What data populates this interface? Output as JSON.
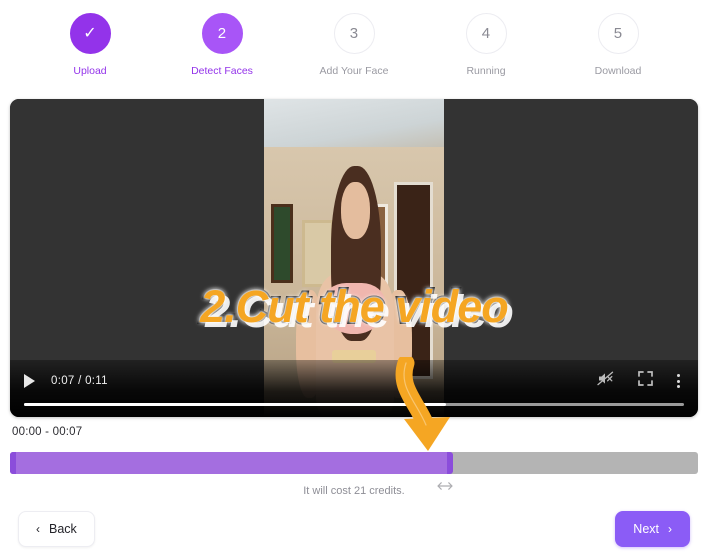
{
  "stepper": {
    "steps": [
      {
        "indicator": "✓",
        "label": "Upload",
        "state": "done"
      },
      {
        "indicator": "2",
        "label": "Detect Faces",
        "state": "active"
      },
      {
        "indicator": "3",
        "label": "Add Your Face",
        "state": "todo"
      },
      {
        "indicator": "4",
        "label": "Running",
        "state": "todo"
      },
      {
        "indicator": "5",
        "label": "Download",
        "state": "todo"
      }
    ]
  },
  "video": {
    "overlay_text": "2.Cut the video",
    "current_time": "0:07",
    "duration": "0:11",
    "time_display": "0:07 / 0:11",
    "progress_percent": 64,
    "muted": true,
    "icons": {
      "play": "play-icon",
      "mute": "muted-volume-icon",
      "fullscreen": "fullscreen-icon",
      "menu": "more-options-icon"
    }
  },
  "trim": {
    "range_label": "00:00 - 00:07",
    "start": "00:00",
    "end": "00:07",
    "selected_percent": 64,
    "credits_note": "It will cost 21 credits.",
    "credits_count": 21
  },
  "annotation": {
    "arrow": "curved-down-arrow",
    "arrow_color": "#F5A623",
    "resize_cursor": "horizontal-resize-cursor"
  },
  "footer": {
    "back_label": "Back",
    "next_label": "Next",
    "back_chevron": "‹",
    "next_chevron": "›"
  },
  "colors": {
    "accent_purple": "#9333EA",
    "active_purple": "#A855F7",
    "button_purple": "#8B5CF6",
    "trim_fill": "#A46EE0",
    "trim_handle": "#8B4DDB",
    "trim_track": "#B4B4B4",
    "overlay_gold": "#F5A623",
    "video_bg": "#333333"
  }
}
